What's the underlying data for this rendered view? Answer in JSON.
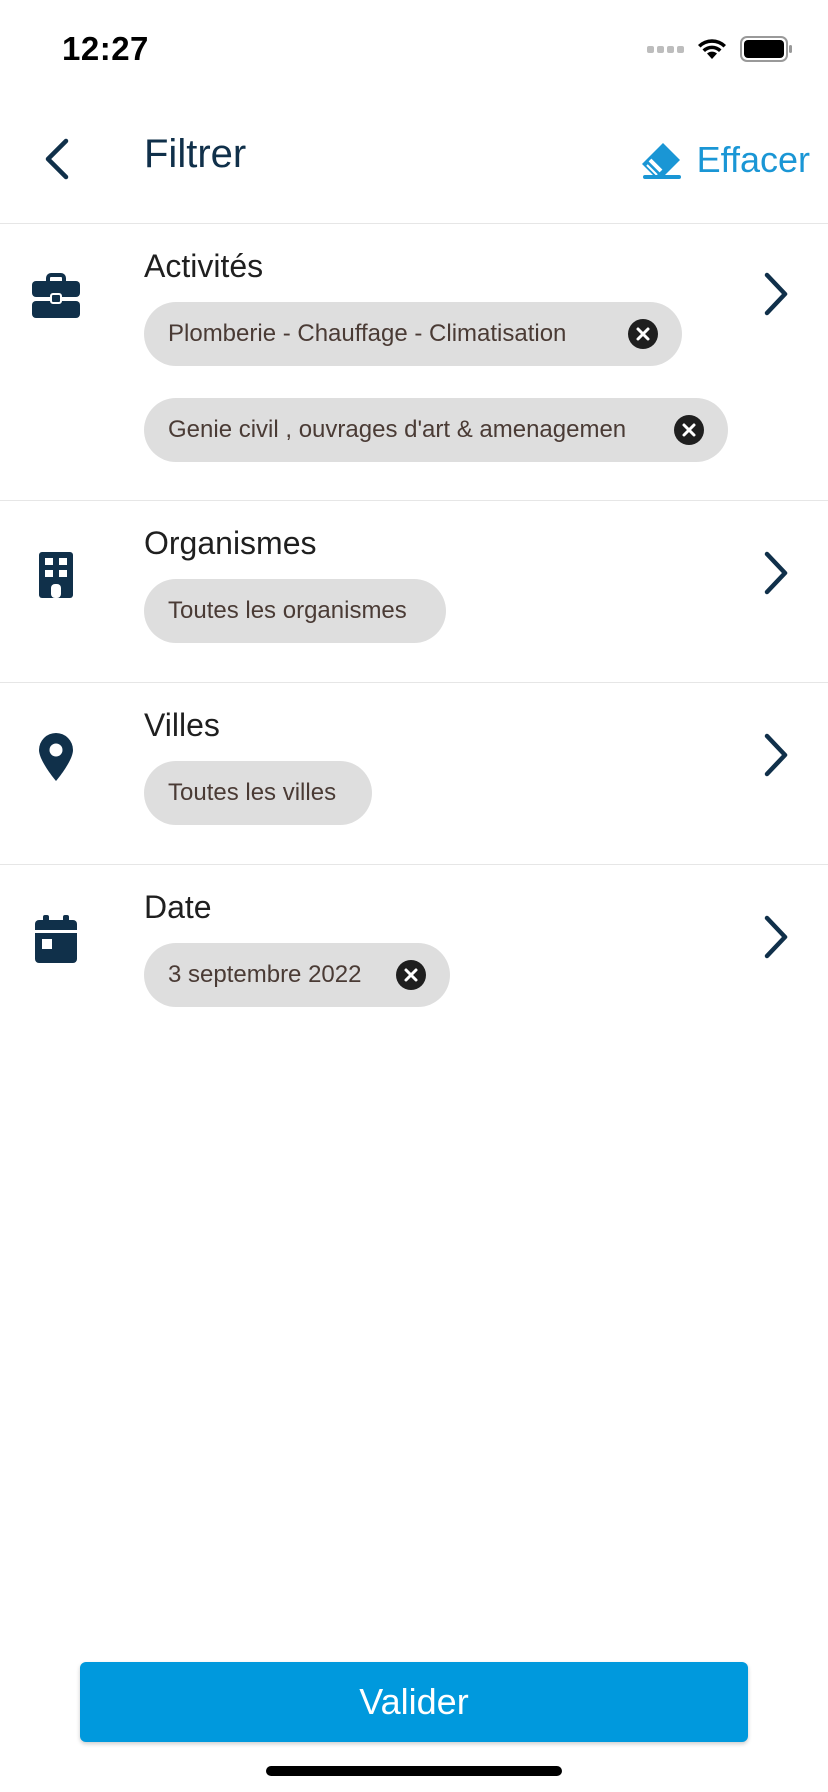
{
  "status_bar": {
    "time": "12:27"
  },
  "header": {
    "title": "Filtrer",
    "clear_label": "Effacer"
  },
  "sections": {
    "activites": {
      "title": "Activités",
      "chips": [
        "Plomberie - Chauffage -  Climatisation",
        "Genie civil , ouvrages d'art & amenagemen"
      ]
    },
    "organismes": {
      "title": "Organismes",
      "chip": "Toutes les organismes"
    },
    "villes": {
      "title": "Villes",
      "chip": "Toutes les villes"
    },
    "date": {
      "title": "Date",
      "chip": "3 septembre 2022"
    }
  },
  "footer": {
    "validate_label": "Valider"
  },
  "colors": {
    "accent": "#0099dd",
    "navy": "#10304a",
    "chip_bg": "#dedede",
    "divider": "#e6e6e6"
  }
}
